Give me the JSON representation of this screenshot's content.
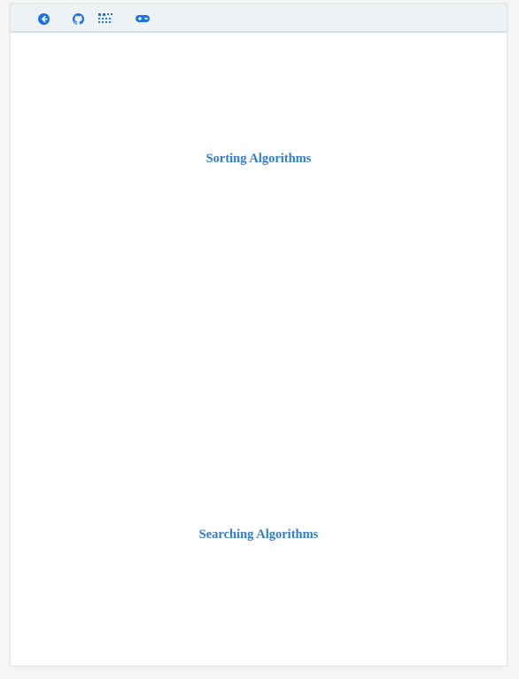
{
  "toolbar": {
    "icons": [
      "back-arrow-icon",
      "github-icon",
      "grid-dots-icon",
      "gamepad-icon"
    ],
    "accent_color": "#1a73e8"
  },
  "main": {
    "sections": [
      {
        "title": "Sorting Algorithms"
      },
      {
        "title": "Searching Algorithms"
      }
    ]
  },
  "colors": {
    "title": "#2f7ccf",
    "toolbar_bg": "#eef2f5",
    "page_bg": "#ffffff"
  }
}
